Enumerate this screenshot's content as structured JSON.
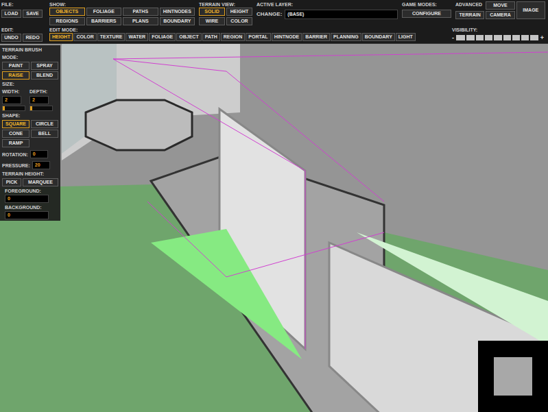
{
  "toolbar": {
    "file": {
      "label": "FILE:",
      "buttons": [
        {
          "label": "LOAD"
        },
        {
          "label": "SAVE"
        }
      ]
    },
    "show": {
      "label": "SHOW:",
      "buttons": [
        {
          "label": "OBJECTS",
          "selected": true
        },
        {
          "label": "FOLIAGE",
          "selected": false
        },
        {
          "label": "PATHS",
          "selected": false
        },
        {
          "label": "HINTNODES",
          "selected": false
        },
        {
          "label": "REGIONS",
          "selected": false
        },
        {
          "label": "BARRIERS",
          "selected": false
        },
        {
          "label": "PLANS",
          "selected": false
        },
        {
          "label": "BOUNDARY",
          "selected": false
        }
      ]
    },
    "terrain_view": {
      "label": "TERRAIN VIEW:",
      "buttons": [
        {
          "label": "SOLID",
          "selected": true
        },
        {
          "label": "HEIGHT",
          "selected": false
        },
        {
          "label": "WIRE",
          "selected": false
        },
        {
          "label": "COLOR",
          "selected": false
        }
      ]
    },
    "active_layer": {
      "label": "ACTIVE LAYER:",
      "field_label": "CHANGE:",
      "value": "(BASE)"
    },
    "game_modes": {
      "label": "GAME MODES:",
      "buttons": [
        {
          "label": "CONFIGURE"
        }
      ]
    },
    "advanced": {
      "label": "ADVANCED",
      "terrain": "TERRAIN",
      "move": "MOVE",
      "camera": "CAMERA",
      "image": "IMAGE"
    },
    "edit": {
      "label": "EDIT:",
      "buttons": [
        {
          "label": "UNDO"
        },
        {
          "label": "REDO"
        }
      ]
    },
    "edit_mode": {
      "label": "EDIT MODE:",
      "buttons": [
        {
          "label": "HEIGHT",
          "selected": true
        },
        {
          "label": "COLOR",
          "selected": false
        },
        {
          "label": "TEXTURE",
          "selected": false
        },
        {
          "label": "WATER",
          "selected": false
        },
        {
          "label": "FOLIAGE",
          "selected": false
        },
        {
          "label": "OBJECT",
          "selected": false
        },
        {
          "label": "PATH",
          "selected": false
        },
        {
          "label": "REGION",
          "selected": false
        },
        {
          "label": "PORTAL",
          "selected": false
        },
        {
          "label": "HINTNODE",
          "selected": false
        },
        {
          "label": "BARRIER",
          "selected": false
        },
        {
          "label": "PLANNING",
          "selected": false
        },
        {
          "label": "BOUNDARY",
          "selected": false
        },
        {
          "label": "LIGHT",
          "selected": false
        }
      ]
    },
    "visibility": {
      "label": "VISIBILITY:",
      "minus": "-",
      "plus": "+",
      "level": 1
    }
  },
  "brush": {
    "title": "TERRAIN BRUSH",
    "mode": {
      "label": "MODE:",
      "options": [
        {
          "label": "PAINT",
          "selected": false
        },
        {
          "label": "SPRAY",
          "selected": false
        },
        {
          "label": "RAISE",
          "selected": true
        },
        {
          "label": "BLEND",
          "selected": false
        }
      ]
    },
    "size": {
      "label": "SIZE:",
      "width": {
        "label": "WIDTH:",
        "value": "2",
        "level": 0.1
      },
      "depth": {
        "label": "DEPTH:",
        "value": "2",
        "level": 0.1
      }
    },
    "shape": {
      "label": "SHAPE:",
      "options": [
        {
          "label": "SQUARE",
          "selected": true
        },
        {
          "label": "CIRCLE",
          "selected": false
        },
        {
          "label": "CONE",
          "selected": false
        },
        {
          "label": "BELL",
          "selected": false
        },
        {
          "label": "RAMP",
          "selected": false
        }
      ]
    },
    "rotation": {
      "label": "ROTATION:",
      "value": "0"
    },
    "pressure": {
      "label": "PRESSURE:",
      "value": "20"
    },
    "terrain_height": {
      "label": "TERRAIN HEIGHT:",
      "buttons": [
        {
          "label": "PICK"
        },
        {
          "label": "MARQUEE"
        }
      ]
    },
    "foreground": {
      "label": "FOREGROUND:",
      "value": "0"
    },
    "background": {
      "label": "BACKGROUND:",
      "value": "0"
    }
  }
}
